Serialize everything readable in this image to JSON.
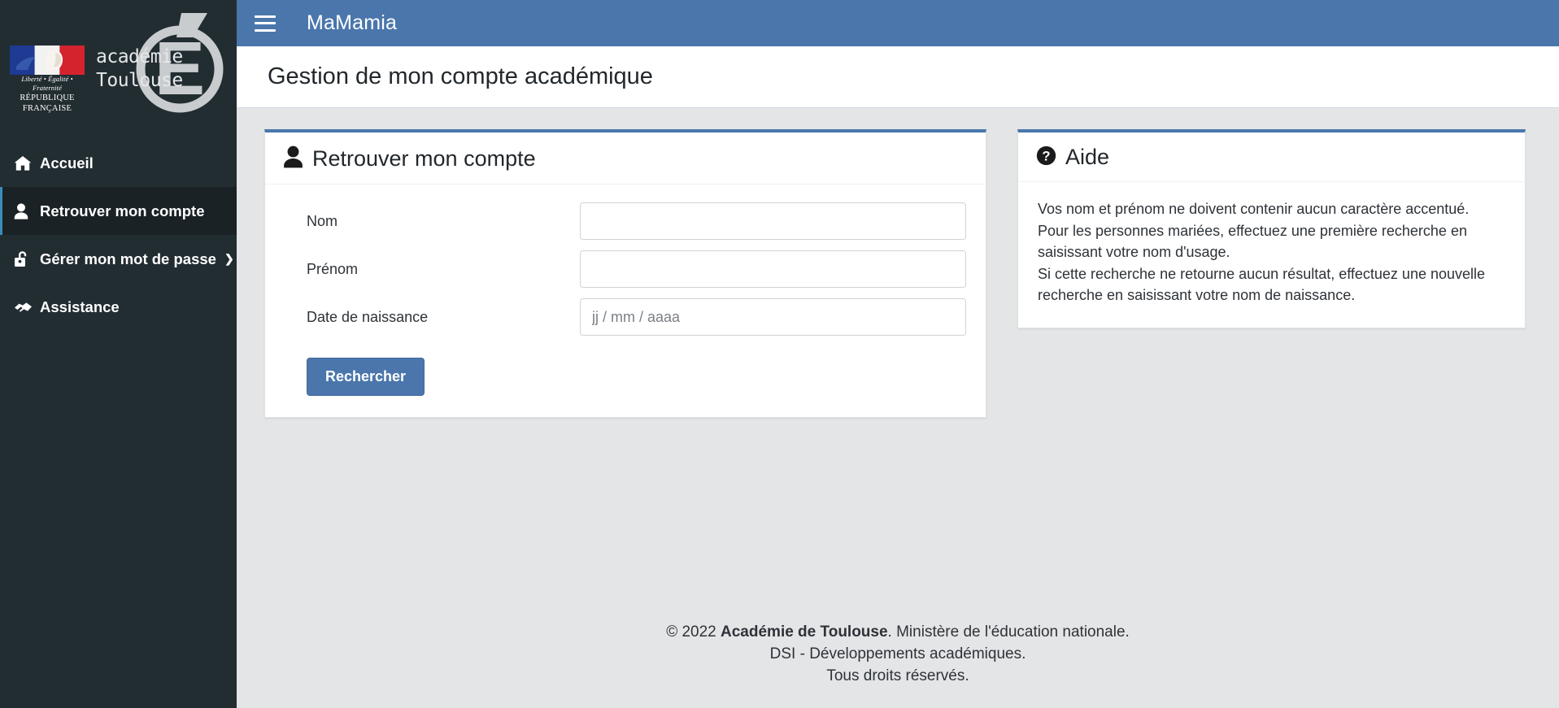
{
  "sidebar": {
    "logo": {
      "marianne_motto": "Liberté • Égalité • Fraternité",
      "marianne_republic": "RÉPUBLIQUE FRANÇAISE",
      "academy_line1": "académie",
      "academy_line2": "Toulouse",
      "academy_monogram": "É"
    },
    "items": [
      {
        "label": "Accueil",
        "icon": "home-icon",
        "active": false,
        "chevron": ""
      },
      {
        "label": "Retrouver mon compte",
        "icon": "user-icon",
        "active": true,
        "chevron": ""
      },
      {
        "label": "Gérer mon mot de passe",
        "icon": "unlock-icon",
        "active": false,
        "chevron": "❯"
      },
      {
        "label": "Assistance",
        "icon": "handshake-icon",
        "active": false,
        "chevron": ""
      }
    ]
  },
  "topbar": {
    "menu_toggle": "hamburger-icon",
    "brand": "MaMamia"
  },
  "page": {
    "title": "Gestion de mon compte académique"
  },
  "form_card": {
    "title": "Retrouver mon compte",
    "icon": "user-icon",
    "fields": [
      {
        "label": "Nom",
        "value": "",
        "placeholder": ""
      },
      {
        "label": "Prénom",
        "value": "",
        "placeholder": ""
      },
      {
        "label": "Date de naissance",
        "value": "",
        "placeholder": "jj / mm / aaaa"
      }
    ],
    "submit_label": "Rechercher"
  },
  "help_card": {
    "title": "Aide",
    "icon": "question-circle-icon",
    "lines": [
      "Vos nom et prénom ne doivent contenir aucun caractère accentué.",
      "Pour les personnes mariées, effectuez une première recherche en saisissant votre nom d'usage.",
      "Si cette recherche ne retourne aucun résultat, effectuez une nouvelle recherche en saisissant votre nom de naissance."
    ]
  },
  "footer": {
    "line1_prefix": "© 2022 ",
    "line1_bold": "Académie de Toulouse",
    "line1_suffix": ". Ministère de l'éducation nationale.",
    "line2": "DSI - Développements académiques.",
    "line3": "Tous droits réservés."
  },
  "colors": {
    "sidebar_bg": "#222d32",
    "sidebar_active_bg": "#1a2226",
    "header_blue": "#4a76ac",
    "content_bg": "#e4e5e7",
    "card_border_top": "#4a76ac",
    "text_dark": "#22272b"
  }
}
